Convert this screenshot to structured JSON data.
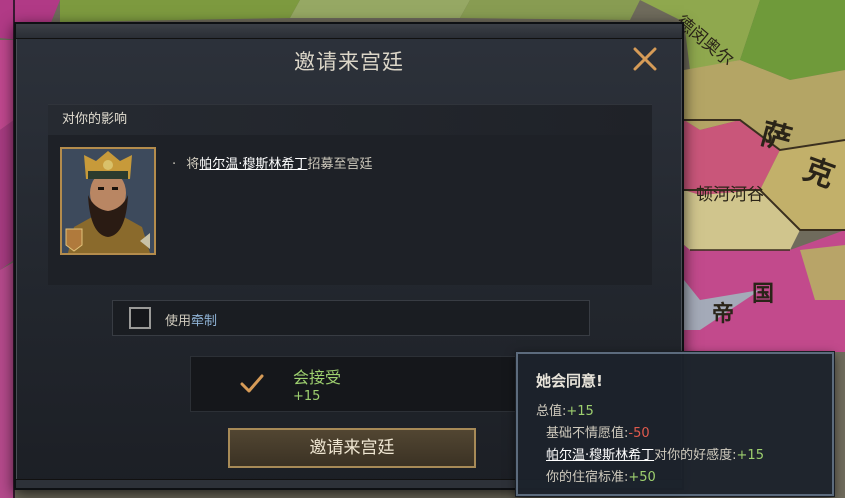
{
  "map": {
    "labels": {
      "top_right": "德闵奥尔",
      "sa": "萨",
      "ke": "克",
      "valley": "顿河河谷",
      "di": "帝",
      "guo": "国"
    }
  },
  "dialog": {
    "title": "邀请来宫廷",
    "section_header": "对你的影响",
    "effect": {
      "bullet": "·",
      "prefix": "将",
      "character_name": "帕尔温·穆斯林希丁",
      "suffix": "招募至宫廷"
    },
    "checkbox": {
      "label_prefix": "使用",
      "label_highlight": "牵制"
    },
    "acceptance": {
      "text": "会接受",
      "score": "+15"
    },
    "invite_button": "邀请来宫廷"
  },
  "tooltip": {
    "title": "她会同意!",
    "total_label": "总值:",
    "total_value": "+15",
    "base_label": "基础不情愿值:",
    "base_value": "-50",
    "opinion_name": "帕尔温·穆斯林希丁",
    "opinion_label": "对你的好感度:",
    "opinion_value": "+15",
    "living_label": "你的住宿标准:",
    "living_value": "+50"
  },
  "colors": {
    "positive": "#9ed06f",
    "negative": "#e05a4d",
    "gold_border": "#a78a57"
  }
}
